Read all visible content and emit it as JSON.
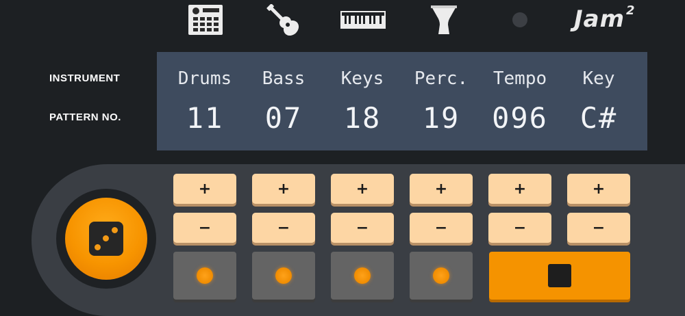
{
  "logo": {
    "text": "Jam",
    "superscript": "2"
  },
  "top_icons": [
    "drum-machine-icon",
    "guitar-icon",
    "keyboard-icon",
    "percussion-drum-icon",
    "status-light-icon"
  ],
  "labels": {
    "instrument": "INSTRUMENT",
    "pattern": "PATTERN NO."
  },
  "columns": [
    {
      "name": "Drums",
      "value": "11"
    },
    {
      "name": "Bass",
      "value": "07"
    },
    {
      "name": "Keys",
      "value": "18"
    },
    {
      "name": "Perc.",
      "value": "19"
    },
    {
      "name": "Tempo",
      "value": "096"
    },
    {
      "name": "Key",
      "value": "C#"
    }
  ],
  "buttons": {
    "plus": "+",
    "minus": "−"
  },
  "colors": {
    "accent": "#f59300",
    "display_bg": "#3e4b5e",
    "pad": "#fdd6a4",
    "background": "#1d2023"
  }
}
